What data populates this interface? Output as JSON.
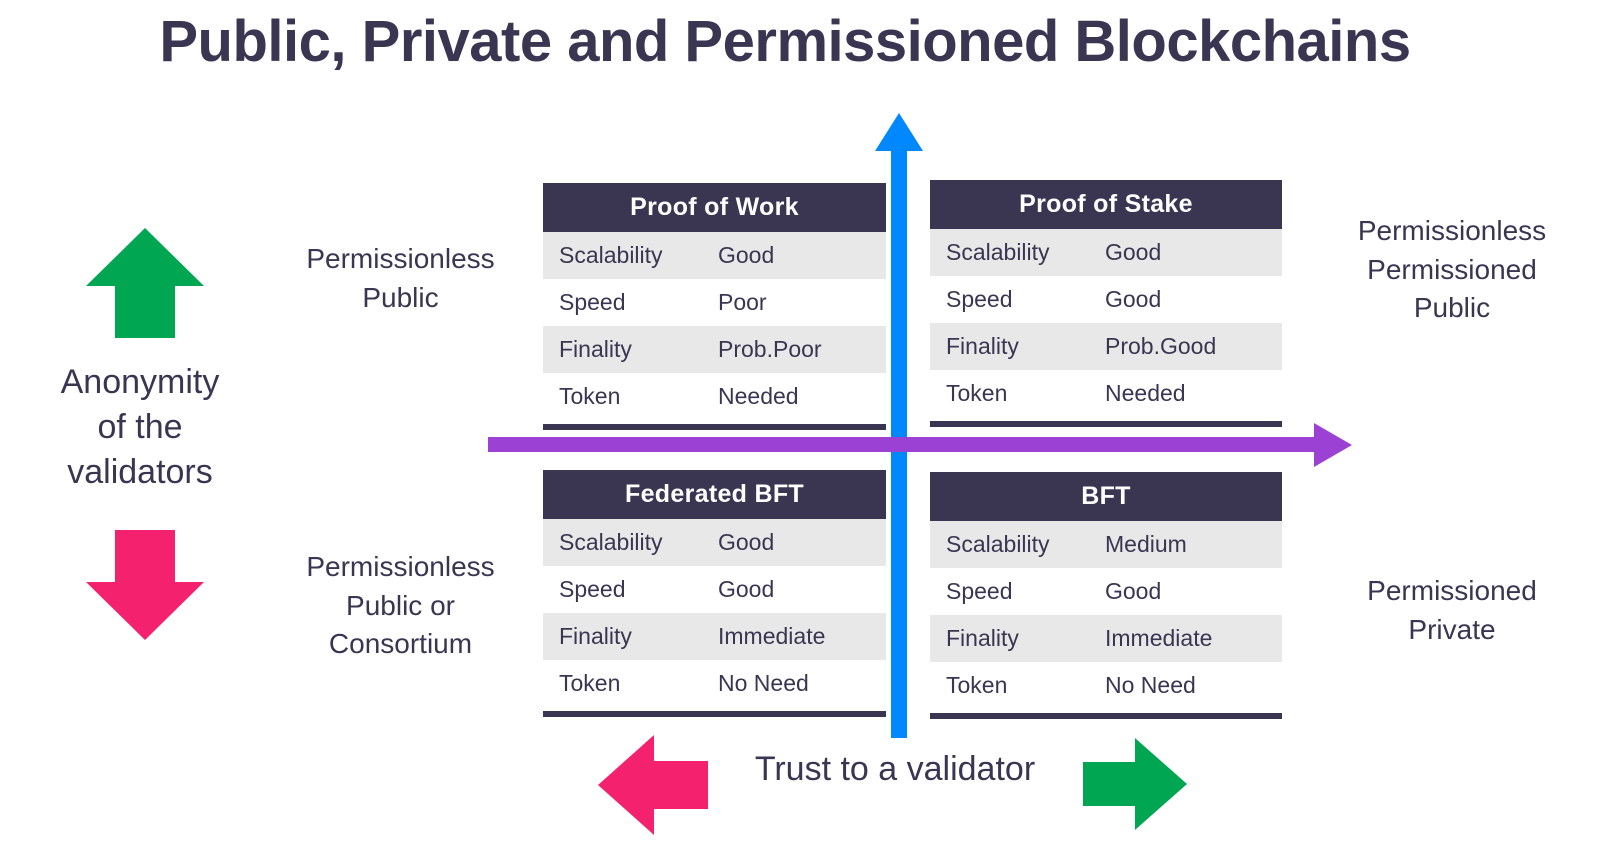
{
  "title": "Public, Private and Permissioned Blockchains",
  "axes": {
    "vertical": {
      "caption": "Anonymity\nof the\nvalidators",
      "caption_lines": [
        "Anonymity",
        "of the",
        "validators"
      ],
      "arrow_color": "#0288fe",
      "up_marker_color": "#00a651",
      "down_marker_color": "#f4226e"
    },
    "horizontal": {
      "caption": "Trust to a validator",
      "arrow_color": "#9b42d4",
      "left_marker_color": "#f4226e",
      "right_marker_color": "#00a651"
    }
  },
  "quadrant_labels": {
    "top_left": [
      "Permissionless",
      "Public"
    ],
    "bottom_left": [
      "Permissionless",
      "Public or",
      "Consortium"
    ],
    "top_right": [
      "Permissionless",
      "Permissioned",
      "Public"
    ],
    "bottom_right": [
      "Permissioned",
      "Private"
    ]
  },
  "colors": {
    "header_bg": "#3a3652",
    "row_alt_bg": "#e8e8e8",
    "row_bg": "#ffffff",
    "text": "#3a3652"
  },
  "tables": [
    {
      "id": "proof-of-work",
      "header": "Proof of Work",
      "rows": [
        {
          "key": "Scalability",
          "value": "Good"
        },
        {
          "key": "Speed",
          "value": "Poor"
        },
        {
          "key": "Finality",
          "value": "Prob.Poor"
        },
        {
          "key": "Token",
          "value": "Needed"
        }
      ]
    },
    {
      "id": "proof-of-stake",
      "header": "Proof of Stake",
      "rows": [
        {
          "key": "Scalability",
          "value": "Good"
        },
        {
          "key": "Speed",
          "value": "Good"
        },
        {
          "key": "Finality",
          "value": "Prob.Good"
        },
        {
          "key": "Token",
          "value": "Needed"
        }
      ]
    },
    {
      "id": "federated-bft",
      "header": "Federated BFT",
      "rows": [
        {
          "key": "Scalability",
          "value": "Good"
        },
        {
          "key": "Speed",
          "value": "Good"
        },
        {
          "key": "Finality",
          "value": "Immediate"
        },
        {
          "key": "Token",
          "value": "No Need"
        }
      ]
    },
    {
      "id": "bft",
      "header": "BFT",
      "rows": [
        {
          "key": "Scalability",
          "value": "Medium"
        },
        {
          "key": "Speed",
          "value": "Good"
        },
        {
          "key": "Finality",
          "value": "Immediate"
        },
        {
          "key": "Token",
          "value": "No Need"
        }
      ]
    }
  ]
}
